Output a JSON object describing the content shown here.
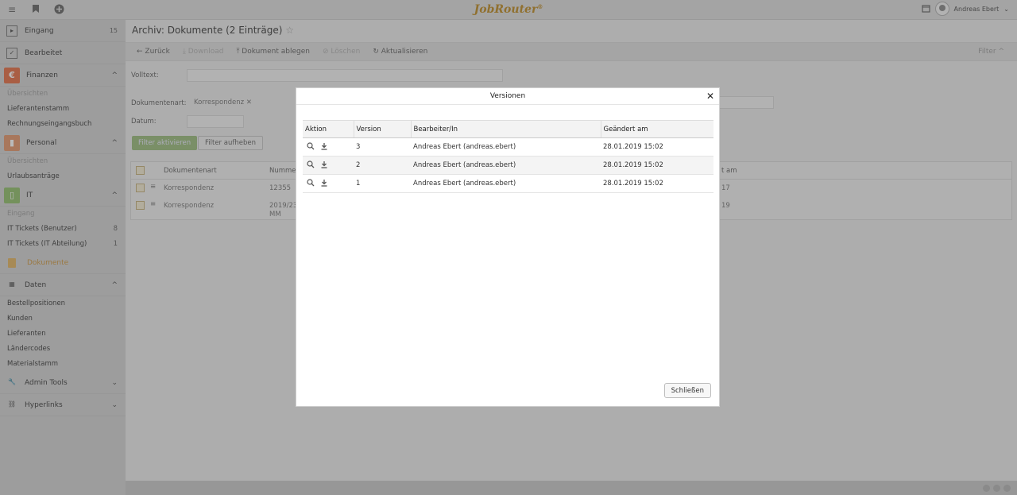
{
  "app": {
    "logo": "JobRouter",
    "logo_mark": "®",
    "user": "Andreas Ebert"
  },
  "sidebar": {
    "inbox": {
      "label": "Eingang",
      "count": "15"
    },
    "done": {
      "label": "Bearbeitet"
    },
    "finance": {
      "label": "Finanzen",
      "tile": "€",
      "color": "#e8825e",
      "items": [
        "Übersichten",
        "Lieferantenstamm",
        "Rechnungseingangsbuch"
      ]
    },
    "personal": {
      "label": "Personal",
      "color": "#e7a37f",
      "items": [
        "Übersichten",
        "Urlaubsanträge"
      ]
    },
    "it": {
      "label": "IT",
      "color": "#9fc77e",
      "items": [
        {
          "label": "Eingang",
          "count": ""
        },
        {
          "label": "IT Tickets (Benutzer)",
          "count": "8"
        },
        {
          "label": "IT Tickets (IT Abteilung)",
          "count": "1"
        }
      ]
    },
    "documents": {
      "label": "Dokumente"
    },
    "data": {
      "label": "Daten",
      "items": [
        "Bestellpositionen",
        "Kunden",
        "Lieferanten",
        "Ländercodes",
        "Materialstamm"
      ]
    },
    "admin": {
      "label": "Admin Tools"
    },
    "links": {
      "label": "Hyperlinks"
    }
  },
  "main": {
    "title": "Archiv: Dokumente (2 Einträge)",
    "toolbar": {
      "back": "Zurück",
      "download": "Download",
      "store": "Dokument ablegen",
      "delete": "Löschen",
      "refresh": "Aktualisieren",
      "filter": "Filter"
    },
    "filters": {
      "fulltext_label": "Volltext:",
      "doctype_label": "Dokumentenart:",
      "doctype_value": "Korrespondenz",
      "date_label": "Datum:",
      "apply": "Filter aktivieren",
      "clear": "Filter aufheben"
    },
    "bg_table": {
      "headers": [
        "Dokumentenart",
        "Numme",
        "t am"
      ],
      "rows": [
        {
          "type": "Korrespondenz",
          "number": "12355",
          "date": "17"
        },
        {
          "type": "Korrespondenz",
          "number": "2019/23",
          "number2": "MM",
          "date": "19"
        }
      ]
    }
  },
  "modal": {
    "title": "Versionen",
    "headers": [
      "Aktion",
      "Version",
      "Bearbeiter/In",
      "Geändert am"
    ],
    "rows": [
      {
        "version": "3",
        "editor": "Andreas Ebert (andreas.ebert)",
        "changed": "28.01.2019 15:02"
      },
      {
        "version": "2",
        "editor": "Andreas Ebert (andreas.ebert)",
        "changed": "28.01.2019 15:02"
      },
      {
        "version": "1",
        "editor": "Andreas Ebert (andreas.ebert)",
        "changed": "28.01.2019 15:02"
      }
    ],
    "close_label": "Schließen"
  }
}
